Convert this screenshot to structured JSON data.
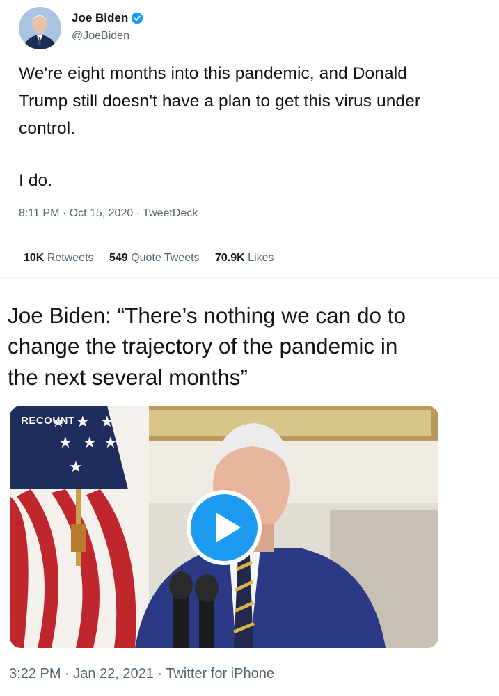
{
  "tweet_top": {
    "author_name": "Joe Biden",
    "author_handle": "@JoeBiden",
    "text_lines": [
      "We're eight months into this pandemic, and Donald",
      "Trump still doesn't have a plan to get this virus under",
      "control."
    ],
    "text_second_paragraph": "I do.",
    "meta": "8:11 PM · Oct 15, 2020 · TweetDeck",
    "stats": {
      "retweets_count": "10K",
      "retweets_label": "Retweets",
      "quote_tweets_count": "549",
      "quote_tweets_label": "Quote Tweets",
      "likes_count": "70.9K",
      "likes_label": "Likes"
    }
  },
  "tweet_bottom": {
    "text_lines": [
      "Joe Biden: “There’s nothing we can do to",
      "change the trajectory of the pandemic in",
      "the next several months”"
    ],
    "video": {
      "watermark": "RECOUNT",
      "play_icon": "play-icon"
    },
    "meta": "3:22 PM · Jan 22, 2021 · Twitter for iPhone"
  },
  "colors": {
    "accent": "#1d9bf0",
    "text_primary": "#0f1419",
    "text_secondary": "#536471"
  }
}
